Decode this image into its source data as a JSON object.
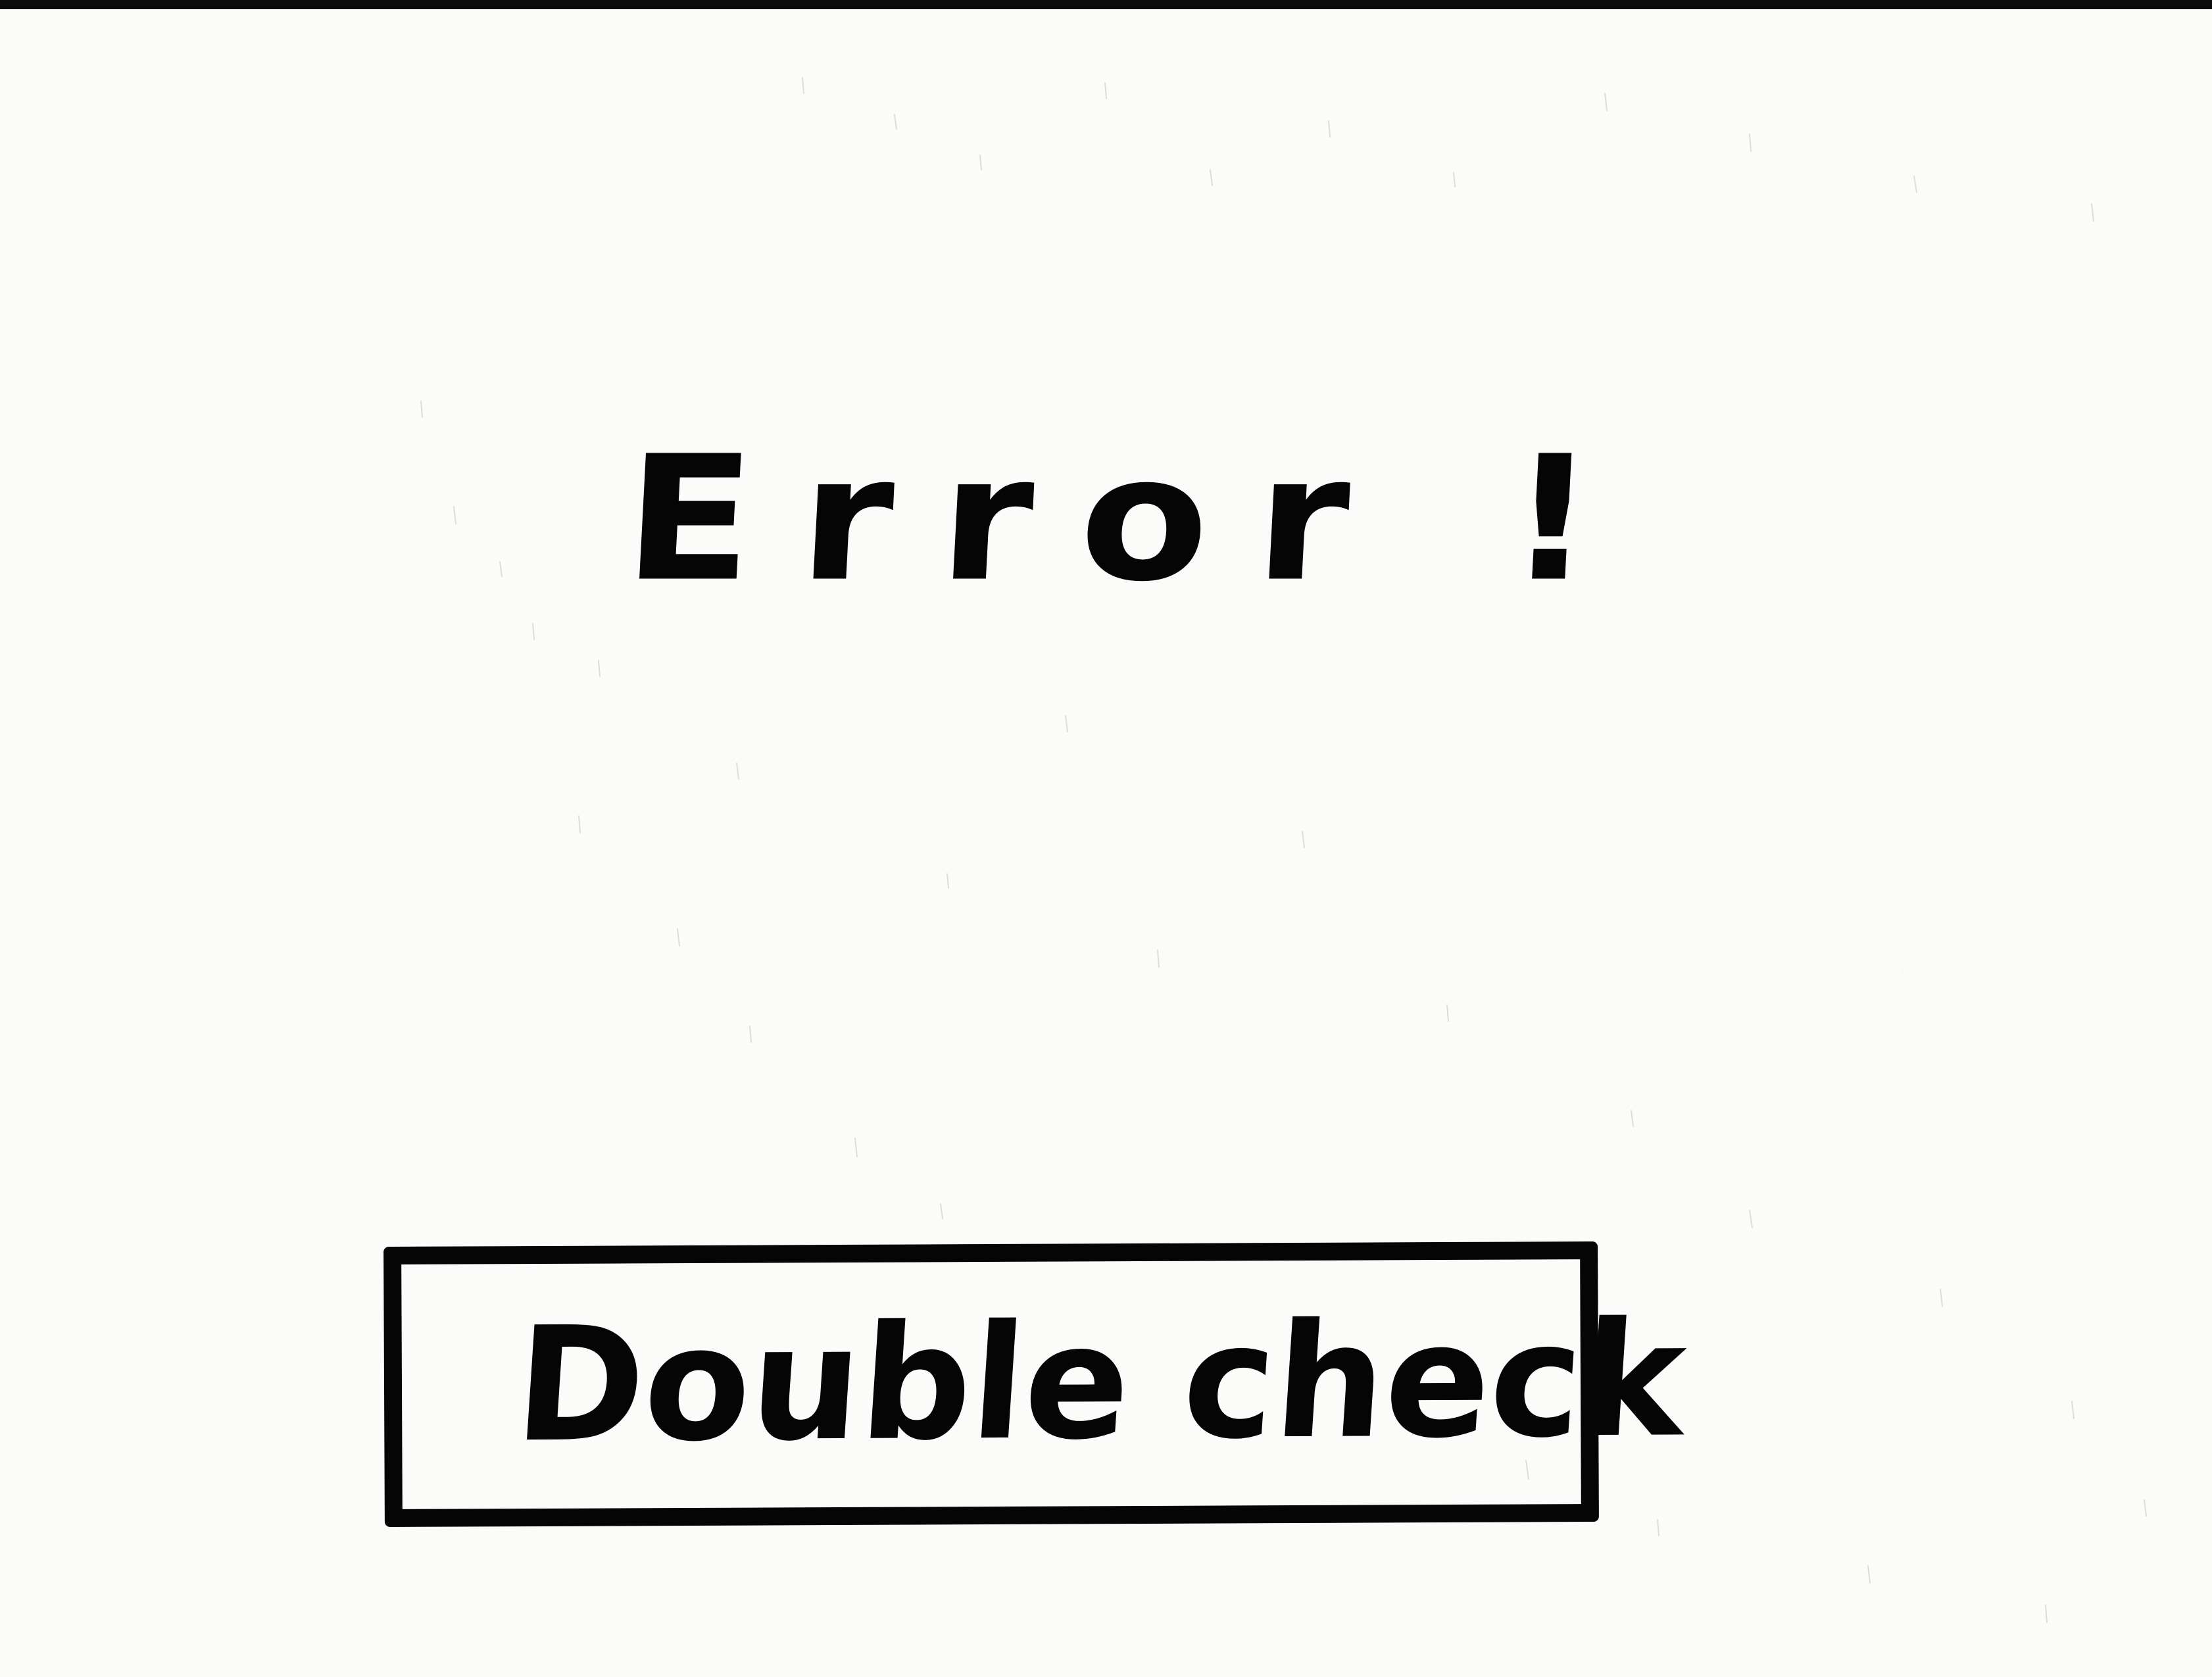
{
  "dialog": {
    "title": "Error !",
    "action_button_label": "Double check"
  },
  "colors": {
    "background": "#fbfbfa",
    "ink": "#050505"
  }
}
